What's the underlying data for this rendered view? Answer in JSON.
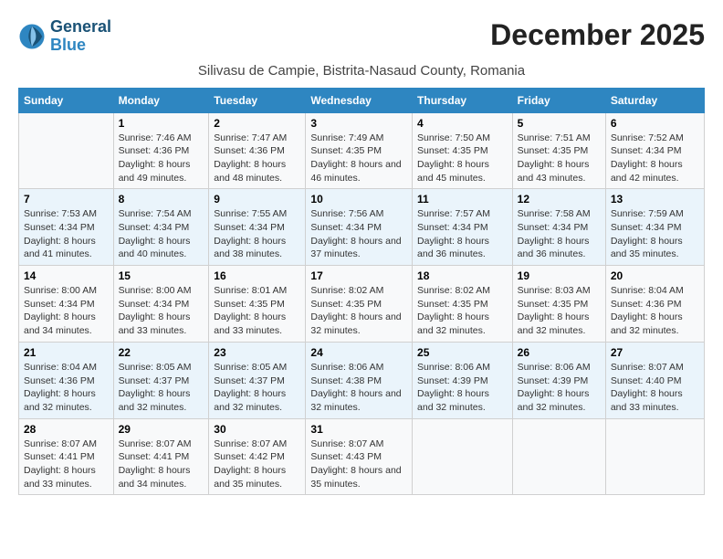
{
  "header": {
    "logo_line1": "General",
    "logo_line2": "Blue",
    "title": "December 2025",
    "subtitle": "Silivasu de Campie, Bistrita-Nasaud County, Romania"
  },
  "columns": [
    "Sunday",
    "Monday",
    "Tuesday",
    "Wednesday",
    "Thursday",
    "Friday",
    "Saturday"
  ],
  "weeks": [
    [
      {
        "day": "",
        "sunrise": "",
        "sunset": "",
        "daylight": ""
      },
      {
        "day": "1",
        "sunrise": "Sunrise: 7:46 AM",
        "sunset": "Sunset: 4:36 PM",
        "daylight": "Daylight: 8 hours and 49 minutes."
      },
      {
        "day": "2",
        "sunrise": "Sunrise: 7:47 AM",
        "sunset": "Sunset: 4:36 PM",
        "daylight": "Daylight: 8 hours and 48 minutes."
      },
      {
        "day": "3",
        "sunrise": "Sunrise: 7:49 AM",
        "sunset": "Sunset: 4:35 PM",
        "daylight": "Daylight: 8 hours and 46 minutes."
      },
      {
        "day": "4",
        "sunrise": "Sunrise: 7:50 AM",
        "sunset": "Sunset: 4:35 PM",
        "daylight": "Daylight: 8 hours and 45 minutes."
      },
      {
        "day": "5",
        "sunrise": "Sunrise: 7:51 AM",
        "sunset": "Sunset: 4:35 PM",
        "daylight": "Daylight: 8 hours and 43 minutes."
      },
      {
        "day": "6",
        "sunrise": "Sunrise: 7:52 AM",
        "sunset": "Sunset: 4:34 PM",
        "daylight": "Daylight: 8 hours and 42 minutes."
      }
    ],
    [
      {
        "day": "7",
        "sunrise": "Sunrise: 7:53 AM",
        "sunset": "Sunset: 4:34 PM",
        "daylight": "Daylight: 8 hours and 41 minutes."
      },
      {
        "day": "8",
        "sunrise": "Sunrise: 7:54 AM",
        "sunset": "Sunset: 4:34 PM",
        "daylight": "Daylight: 8 hours and 40 minutes."
      },
      {
        "day": "9",
        "sunrise": "Sunrise: 7:55 AM",
        "sunset": "Sunset: 4:34 PM",
        "daylight": "Daylight: 8 hours and 38 minutes."
      },
      {
        "day": "10",
        "sunrise": "Sunrise: 7:56 AM",
        "sunset": "Sunset: 4:34 PM",
        "daylight": "Daylight: 8 hours and 37 minutes."
      },
      {
        "day": "11",
        "sunrise": "Sunrise: 7:57 AM",
        "sunset": "Sunset: 4:34 PM",
        "daylight": "Daylight: 8 hours and 36 minutes."
      },
      {
        "day": "12",
        "sunrise": "Sunrise: 7:58 AM",
        "sunset": "Sunset: 4:34 PM",
        "daylight": "Daylight: 8 hours and 36 minutes."
      },
      {
        "day": "13",
        "sunrise": "Sunrise: 7:59 AM",
        "sunset": "Sunset: 4:34 PM",
        "daylight": "Daylight: 8 hours and 35 minutes."
      }
    ],
    [
      {
        "day": "14",
        "sunrise": "Sunrise: 8:00 AM",
        "sunset": "Sunset: 4:34 PM",
        "daylight": "Daylight: 8 hours and 34 minutes."
      },
      {
        "day": "15",
        "sunrise": "Sunrise: 8:00 AM",
        "sunset": "Sunset: 4:34 PM",
        "daylight": "Daylight: 8 hours and 33 minutes."
      },
      {
        "day": "16",
        "sunrise": "Sunrise: 8:01 AM",
        "sunset": "Sunset: 4:35 PM",
        "daylight": "Daylight: 8 hours and 33 minutes."
      },
      {
        "day": "17",
        "sunrise": "Sunrise: 8:02 AM",
        "sunset": "Sunset: 4:35 PM",
        "daylight": "Daylight: 8 hours and 32 minutes."
      },
      {
        "day": "18",
        "sunrise": "Sunrise: 8:02 AM",
        "sunset": "Sunset: 4:35 PM",
        "daylight": "Daylight: 8 hours and 32 minutes."
      },
      {
        "day": "19",
        "sunrise": "Sunrise: 8:03 AM",
        "sunset": "Sunset: 4:35 PM",
        "daylight": "Daylight: 8 hours and 32 minutes."
      },
      {
        "day": "20",
        "sunrise": "Sunrise: 8:04 AM",
        "sunset": "Sunset: 4:36 PM",
        "daylight": "Daylight: 8 hours and 32 minutes."
      }
    ],
    [
      {
        "day": "21",
        "sunrise": "Sunrise: 8:04 AM",
        "sunset": "Sunset: 4:36 PM",
        "daylight": "Daylight: 8 hours and 32 minutes."
      },
      {
        "day": "22",
        "sunrise": "Sunrise: 8:05 AM",
        "sunset": "Sunset: 4:37 PM",
        "daylight": "Daylight: 8 hours and 32 minutes."
      },
      {
        "day": "23",
        "sunrise": "Sunrise: 8:05 AM",
        "sunset": "Sunset: 4:37 PM",
        "daylight": "Daylight: 8 hours and 32 minutes."
      },
      {
        "day": "24",
        "sunrise": "Sunrise: 8:06 AM",
        "sunset": "Sunset: 4:38 PM",
        "daylight": "Daylight: 8 hours and 32 minutes."
      },
      {
        "day": "25",
        "sunrise": "Sunrise: 8:06 AM",
        "sunset": "Sunset: 4:39 PM",
        "daylight": "Daylight: 8 hours and 32 minutes."
      },
      {
        "day": "26",
        "sunrise": "Sunrise: 8:06 AM",
        "sunset": "Sunset: 4:39 PM",
        "daylight": "Daylight: 8 hours and 32 minutes."
      },
      {
        "day": "27",
        "sunrise": "Sunrise: 8:07 AM",
        "sunset": "Sunset: 4:40 PM",
        "daylight": "Daylight: 8 hours and 33 minutes."
      }
    ],
    [
      {
        "day": "28",
        "sunrise": "Sunrise: 8:07 AM",
        "sunset": "Sunset: 4:41 PM",
        "daylight": "Daylight: 8 hours and 33 minutes."
      },
      {
        "day": "29",
        "sunrise": "Sunrise: 8:07 AM",
        "sunset": "Sunset: 4:41 PM",
        "daylight": "Daylight: 8 hours and 34 minutes."
      },
      {
        "day": "30",
        "sunrise": "Sunrise: 8:07 AM",
        "sunset": "Sunset: 4:42 PM",
        "daylight": "Daylight: 8 hours and 35 minutes."
      },
      {
        "day": "31",
        "sunrise": "Sunrise: 8:07 AM",
        "sunset": "Sunset: 4:43 PM",
        "daylight": "Daylight: 8 hours and 35 minutes."
      },
      {
        "day": "",
        "sunrise": "",
        "sunset": "",
        "daylight": ""
      },
      {
        "day": "",
        "sunrise": "",
        "sunset": "",
        "daylight": ""
      },
      {
        "day": "",
        "sunrise": "",
        "sunset": "",
        "daylight": ""
      }
    ]
  ]
}
